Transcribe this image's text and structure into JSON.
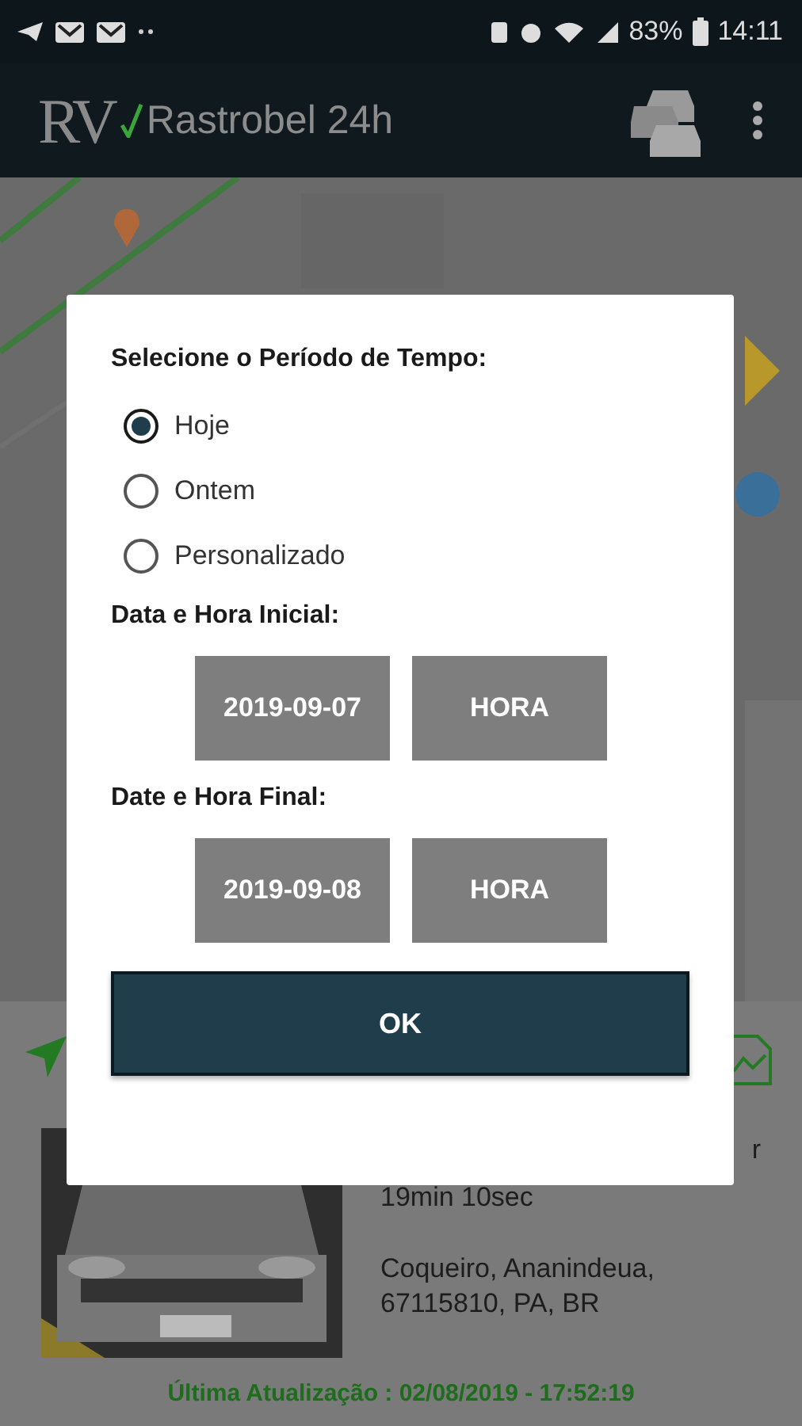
{
  "status_bar": {
    "battery": "83%",
    "time": "14:11"
  },
  "app_bar": {
    "logo": "RV",
    "title": "Rastrobel 24h"
  },
  "vehicle_card": {
    "elapsed_fragment": "r",
    "elapsed": "19min 10sec",
    "address": "Coqueiro, Ananindeua, 67115810, PA, BR",
    "last_update": "Última Atualização : 02/08/2019 - 17:52:19"
  },
  "dialog": {
    "title": "Selecione o Período de Tempo:",
    "options": [
      {
        "label": "Hoje",
        "selected": true
      },
      {
        "label": "Ontem",
        "selected": false
      },
      {
        "label": "Personalizado",
        "selected": false
      }
    ],
    "ranges": [
      {
        "label": "Data e Hora Inicial:",
        "date": "2019-09-07",
        "time": "HORA"
      },
      {
        "label": "Date e Hora Final:",
        "date": "2019-09-08",
        "time": "HORA"
      }
    ],
    "button": "OK"
  }
}
